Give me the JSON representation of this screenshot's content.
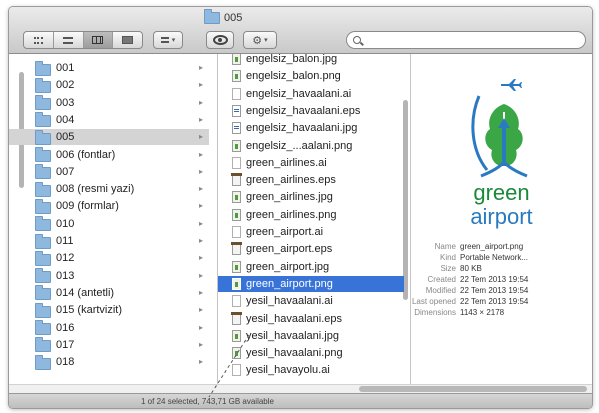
{
  "window": {
    "title": "005"
  },
  "toolbar": {
    "view_modes": [
      "icons",
      "list",
      "columns",
      "cover-flow"
    ],
    "active_view": "columns",
    "arrange_label": "▾",
    "action_label": "▾",
    "search_value": ""
  },
  "sidebar_chevron": "▸",
  "folders": [
    {
      "name": "001"
    },
    {
      "name": "002"
    },
    {
      "name": "003"
    },
    {
      "name": "004"
    },
    {
      "name": "005",
      "selected": true
    },
    {
      "name": "006 (fontlar)"
    },
    {
      "name": "007"
    },
    {
      "name": "008 (resmi yazi)"
    },
    {
      "name": "009 (formlar)"
    },
    {
      "name": "010"
    },
    {
      "name": "011"
    },
    {
      "name": "012"
    },
    {
      "name": "013"
    },
    {
      "name": "014 (antetli)"
    },
    {
      "name": "015 (kartvizit)"
    },
    {
      "name": "016"
    },
    {
      "name": "017"
    },
    {
      "name": "018"
    }
  ],
  "files": [
    {
      "name": "engelsiz_balon.jpg",
      "type": "jpg"
    },
    {
      "name": "engelsiz_balon.png",
      "type": "png"
    },
    {
      "name": "engelsiz_havaalani.ai",
      "type": "ai"
    },
    {
      "name": "engelsiz_havaalani.eps",
      "type": "doc"
    },
    {
      "name": "engelsiz_havaalani.jpg",
      "type": "doc"
    },
    {
      "name": "engelsiz_...aalani.png",
      "type": "png"
    },
    {
      "name": "green_airlines.ai",
      "type": "ai"
    },
    {
      "name": "green_airlines.eps",
      "type": "eps"
    },
    {
      "name": "green_airlines.jpg",
      "type": "jpg"
    },
    {
      "name": "green_airlines.png",
      "type": "png"
    },
    {
      "name": "green_airport.ai",
      "type": "ai"
    },
    {
      "name": "green_airport.eps",
      "type": "eps"
    },
    {
      "name": "green_airport.jpg",
      "type": "jpg"
    },
    {
      "name": "green_airport.png",
      "type": "png",
      "selected": true
    },
    {
      "name": "yesil_havaalani.ai",
      "type": "ai"
    },
    {
      "name": "yesil_havaalani.eps",
      "type": "eps"
    },
    {
      "name": "yesil_havaalani.jpg",
      "type": "jpg"
    },
    {
      "name": "yesil_havaalani.png",
      "type": "png"
    },
    {
      "name": "yesil_havayolu.ai",
      "type": "ai"
    }
  ],
  "preview": {
    "brand_line1": "green",
    "brand_line2": "airport",
    "colors": {
      "green": "#1a8a3a",
      "blue": "#2a7ac1"
    },
    "info": [
      {
        "label": "Name",
        "value": "green_airport.png"
      },
      {
        "label": "Kind",
        "value": "Portable Network..."
      },
      {
        "label": "Size",
        "value": "80 KB"
      },
      {
        "label": "Created",
        "value": "22 Tem 2013 19:54"
      },
      {
        "label": "Modified",
        "value": "22 Tem 2013 19:54"
      },
      {
        "label": "Last opened",
        "value": "22 Tem 2013 19:54"
      },
      {
        "label": "Dimensions",
        "value": "1143 × 2178"
      }
    ]
  },
  "status": {
    "text": "1 of 24 selected, 743,71 GB available"
  }
}
